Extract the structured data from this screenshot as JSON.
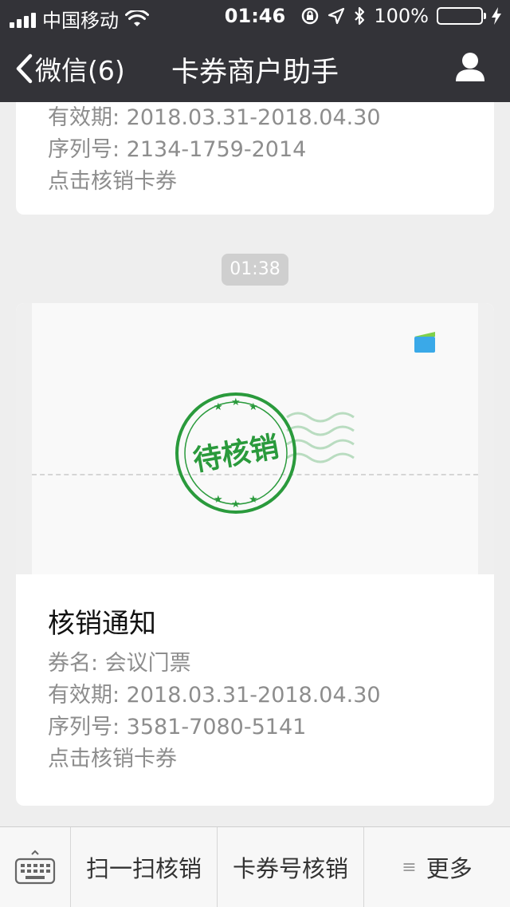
{
  "status_bar": {
    "carrier": "中国移动",
    "time": "01:46",
    "battery_percent": "100%",
    "battery_level": 1.0
  },
  "nav": {
    "back_label": "微信(6)",
    "title": "卡券商户助手",
    "profile_icon": "person-icon"
  },
  "messages": [
    {
      "lines": [
        "有效期: 2018.03.31-2018.04.30",
        "序列号: 2134-1759-2014",
        "点击核销卡券"
      ]
    },
    {
      "timestamp": "01:38"
    },
    {
      "stamp_text": "待核销",
      "title": "核销通知",
      "lines": [
        "券名: 会议门票",
        "有效期: 2018.03.31-2018.04.30",
        "序列号: 3581-7080-5141",
        "点击核销卡券"
      ]
    }
  ],
  "bottom_menu": {
    "keyboard_icon": "keyboard-icon",
    "items": [
      "扫一扫核销",
      "卡券号核销",
      "更多"
    ],
    "more_icon": "menu-lines-icon"
  },
  "colors": {
    "header_bg": "#333338",
    "stamp_green": "#2a9a3c",
    "battery_green": "#4cd964",
    "card_icon_blue": "#3aa9e8",
    "card_icon_green": "#7ed04b"
  }
}
